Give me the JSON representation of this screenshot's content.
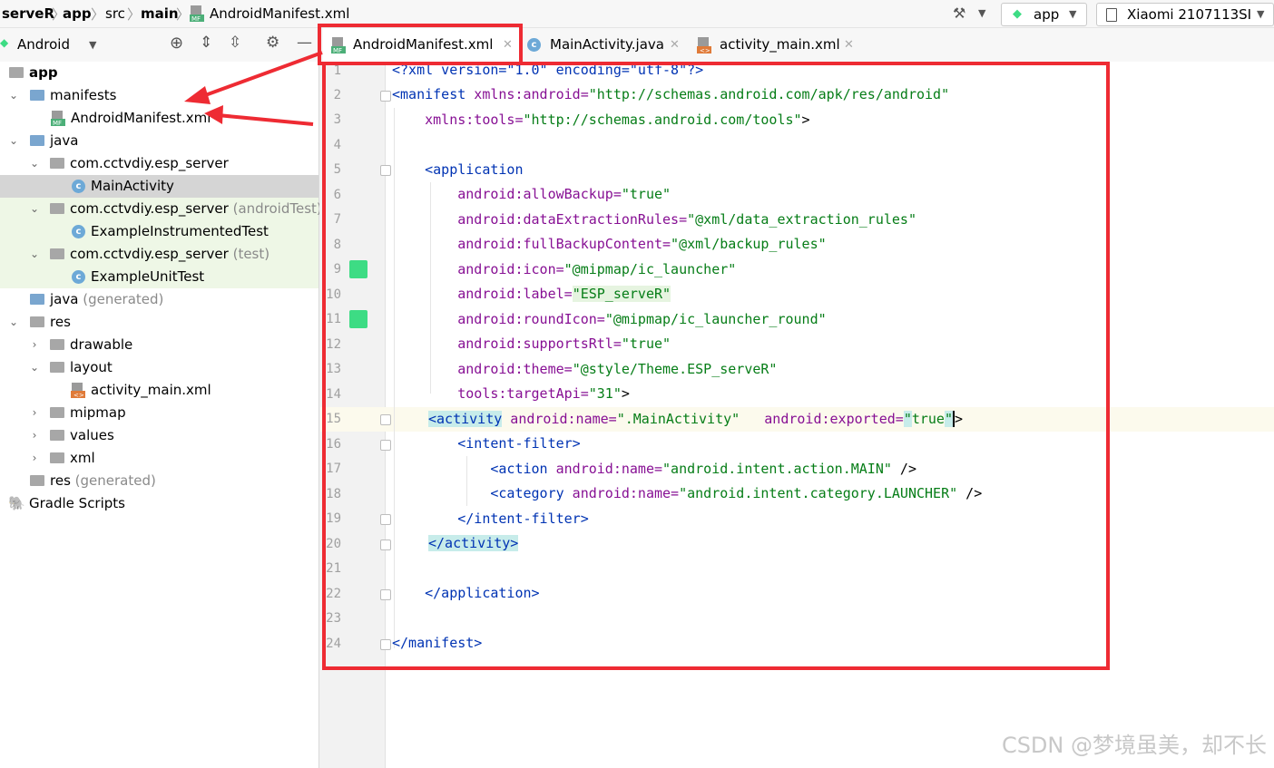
{
  "breadcrumb": [
    "serveR",
    "app",
    "src",
    "main",
    "AndroidManifest.xml"
  ],
  "toolbar": {
    "run_config": "app",
    "device": "Xiaomi 2107113SI"
  },
  "project_panel": {
    "view_mode": "Android"
  },
  "tabs": [
    {
      "label": "AndroidManifest.xml",
      "active": true
    },
    {
      "label": "MainActivity.java",
      "active": false
    },
    {
      "label": "activity_main.xml",
      "active": false
    }
  ],
  "tree": [
    {
      "label": "app",
      "suffix": ""
    },
    {
      "label": "manifests",
      "suffix": ""
    },
    {
      "label": "AndroidManifest.xml",
      "suffix": ""
    },
    {
      "label": "java",
      "suffix": ""
    },
    {
      "label": "com.cctvdiy.esp_server",
      "suffix": ""
    },
    {
      "label": "MainActivity",
      "suffix": ""
    },
    {
      "label": "com.cctvdiy.esp_server",
      "suffix": "(androidTest)"
    },
    {
      "label": "ExampleInstrumentedTest",
      "suffix": ""
    },
    {
      "label": "com.cctvdiy.esp_server",
      "suffix": "(test)"
    },
    {
      "label": "ExampleUnitTest",
      "suffix": ""
    },
    {
      "label": "java",
      "suffix": "(generated)"
    },
    {
      "label": "res",
      "suffix": ""
    },
    {
      "label": "drawable",
      "suffix": ""
    },
    {
      "label": "layout",
      "suffix": ""
    },
    {
      "label": "activity_main.xml",
      "suffix": ""
    },
    {
      "label": "mipmap",
      "suffix": ""
    },
    {
      "label": "values",
      "suffix": ""
    },
    {
      "label": "xml",
      "suffix": ""
    },
    {
      "label": "res",
      "suffix": "(generated)"
    },
    {
      "label": "Gradle Scripts",
      "suffix": ""
    }
  ],
  "line_numbers": [
    "1",
    "2",
    "3",
    "4",
    "5",
    "6",
    "7",
    "8",
    "9",
    "10",
    "11",
    "12",
    "13",
    "14",
    "15",
    "16",
    "17",
    "18",
    "19",
    "20",
    "21",
    "22",
    "23",
    "24"
  ],
  "code": {
    "l1": "<?xml version=\"1.0\" encoding=\"utf-8\"?>",
    "l2a": "<manifest",
    "l2b": " xmlns:android=",
    "l2c": "\"http://schemas.android.com/apk/res/android\"",
    "l3a": "    xmlns:tools=",
    "l3b": "\"http://schemas.android.com/tools\"",
    "l3c": ">",
    "l5": "    <application",
    "l6a": "        android:allowBackup=",
    "l6b": "\"true\"",
    "l7a": "        android:dataExtractionRules=",
    "l7b": "\"@xml/data_extraction_rules\"",
    "l8a": "        android:fullBackupContent=",
    "l8b": "\"@xml/backup_rules\"",
    "l9a": "        android:icon=",
    "l9b": "\"@mipmap/ic_launcher\"",
    "l10a": "        android:label=",
    "l10b": "\"ESP_serveR\"",
    "l11a": "        android:roundIcon=",
    "l11b": "\"@mipmap/ic_launcher_round\"",
    "l12a": "        android:supportsRtl=",
    "l12b": "\"true\"",
    "l13a": "        android:theme=",
    "l13b": "\"@style/Theme.ESP_serveR\"",
    "l14a": "        tools:targetApi=",
    "l14b": "\"31\"",
    "l14c": ">",
    "l15a": "<activity",
    "l15b": " android:name=",
    "l15c": "\".MainActivity\"",
    "l15d": "   android:exported=",
    "l15e": "\"",
    "l15f": "true",
    "l15g": "\"",
    "l15h": ">",
    "l16": "        <intent-filter>",
    "l17a": "            <action",
    "l17b": " android:name=",
    "l17c": "\"android.intent.action.MAIN\"",
    "l17d": " />",
    "l18a": "            <category",
    "l18b": " android:name=",
    "l18c": "\"android.intent.category.LAUNCHER\"",
    "l18d": " />",
    "l19": "        </intent-filter>",
    "l20": "</activity>",
    "l22": "    </application>",
    "l24": "</manifest>"
  },
  "watermark": "CSDN @梦境虽美，却不长",
  "colors": {
    "annotation": "#ee2b33",
    "tag": "#0033b3",
    "attr": "#871094",
    "value": "#067d17"
  }
}
